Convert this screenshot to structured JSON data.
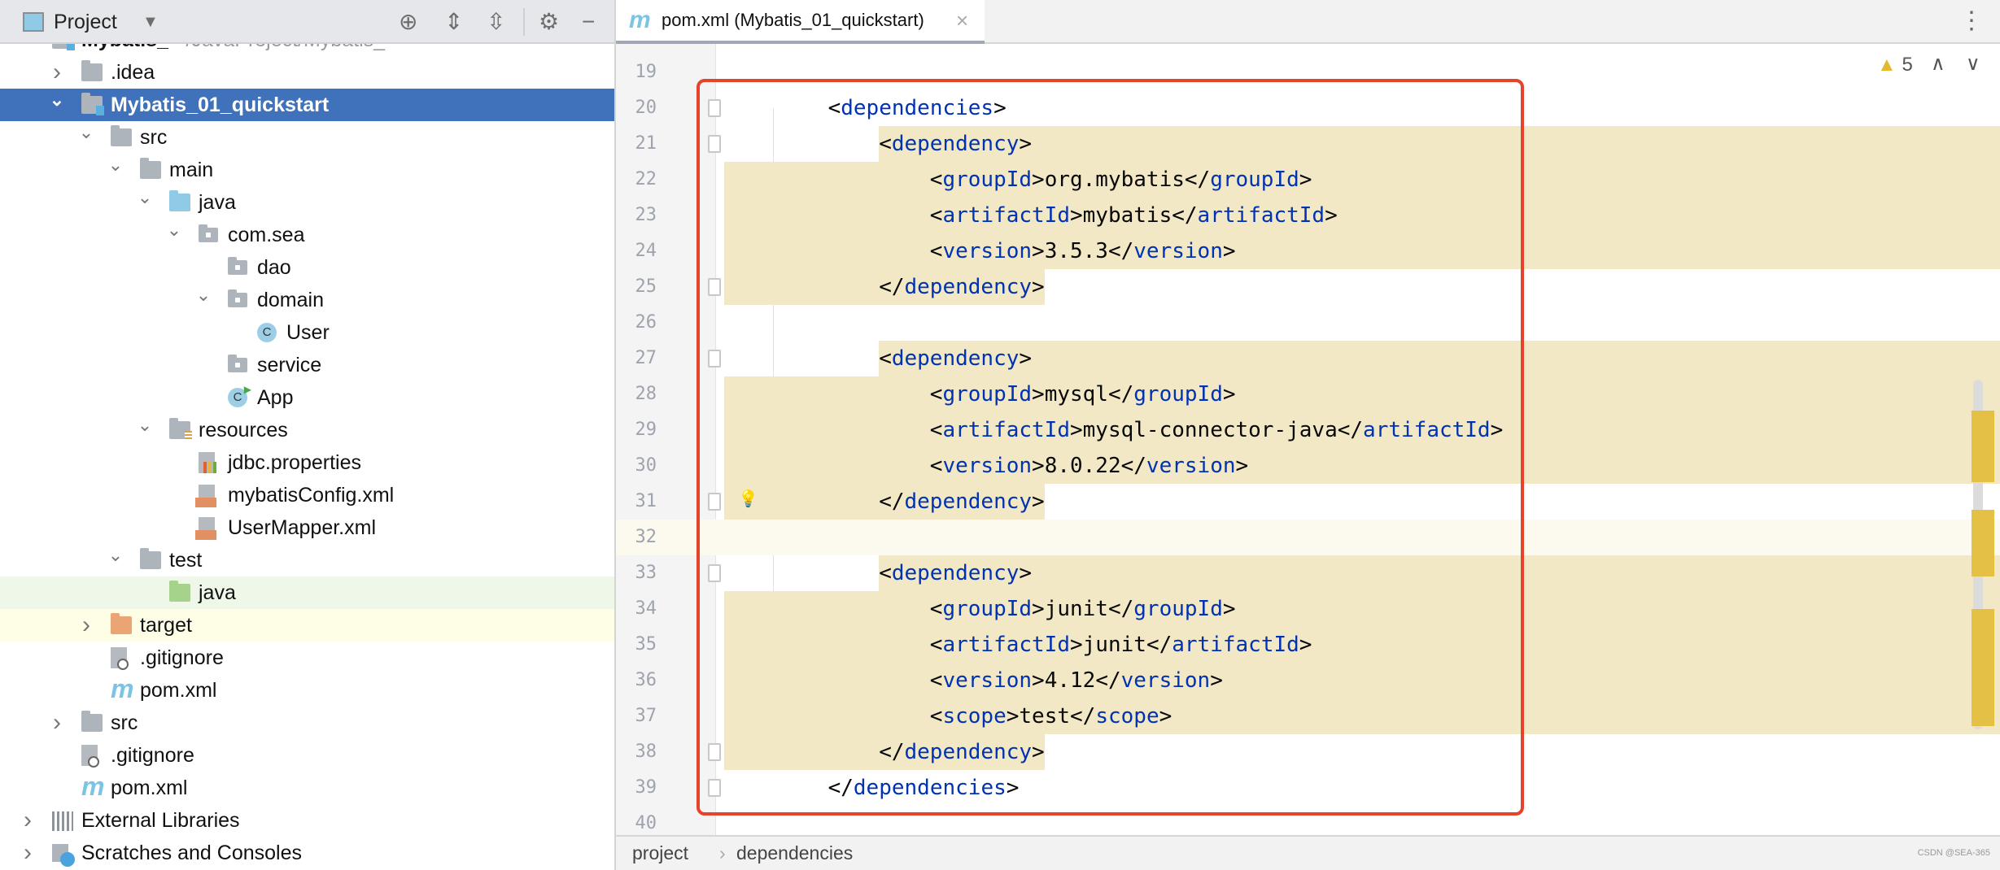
{
  "project_panel": {
    "title": "Project",
    "icons": [
      "locate-icon",
      "expand-all-icon",
      "collapse-all-icon",
      "gear-icon",
      "minimize-icon"
    ],
    "items": [
      {
        "label": "Mybatis_",
        "path": "~/JavaProject/Mybatis_",
        "level": -1,
        "arrow": "none",
        "icon": "module",
        "bold": true
      },
      {
        "label": ".idea",
        "level": 0,
        "arrow": "right",
        "icon": "folder"
      },
      {
        "label": "Mybatis_01_quickstart",
        "level": 0,
        "arrow": "down",
        "icon": "module",
        "state": "selected"
      },
      {
        "label": "src",
        "level": 1,
        "arrow": "down",
        "icon": "folder"
      },
      {
        "label": "main",
        "level": 2,
        "arrow": "down",
        "icon": "folder"
      },
      {
        "label": "java",
        "level": 3,
        "arrow": "down",
        "icon": "source-folder"
      },
      {
        "label": "com.sea",
        "level": 4,
        "arrow": "down",
        "icon": "package"
      },
      {
        "label": "dao",
        "level": 5,
        "arrow": "none",
        "icon": "package"
      },
      {
        "label": "domain",
        "level": 5,
        "arrow": "down",
        "icon": "package"
      },
      {
        "label": "User",
        "level": 6,
        "arrow": "none",
        "icon": "class"
      },
      {
        "label": "service",
        "level": 5,
        "arrow": "none",
        "icon": "package"
      },
      {
        "label": "App",
        "level": 5,
        "arrow": "none",
        "icon": "class-runnable"
      },
      {
        "label": "resources",
        "level": 3,
        "arrow": "down",
        "icon": "resources-folder"
      },
      {
        "label": "jdbc.properties",
        "level": 4,
        "arrow": "none",
        "icon": "properties-file"
      },
      {
        "label": "mybatisConfig.xml",
        "level": 4,
        "arrow": "none",
        "icon": "xml-file"
      },
      {
        "label": "UserMapper.xml",
        "level": 4,
        "arrow": "none",
        "icon": "xml-file"
      },
      {
        "label": "test",
        "level": 2,
        "arrow": "down",
        "icon": "folder"
      },
      {
        "label": "java",
        "level": 3,
        "arrow": "none",
        "icon": "test-folder",
        "state": "green"
      },
      {
        "label": "target",
        "level": 1,
        "arrow": "right",
        "icon": "excluded-folder",
        "state": "yellow"
      },
      {
        "label": ".gitignore",
        "level": 1,
        "arrow": "none",
        "icon": "ignore-file"
      },
      {
        "label": "pom.xml",
        "level": 1,
        "arrow": "none",
        "icon": "maven-file"
      },
      {
        "label": "src",
        "level": 0,
        "arrow": "right",
        "icon": "folder"
      },
      {
        "label": ".gitignore",
        "level": 0,
        "arrow": "none",
        "icon": "ignore-file"
      },
      {
        "label": "pom.xml",
        "level": 0,
        "arrow": "none",
        "icon": "maven-file"
      },
      {
        "label": "External Libraries",
        "level": -1,
        "arrow": "right",
        "icon": "libraries"
      },
      {
        "label": "Scratches and Consoles",
        "level": -1,
        "arrow": "right",
        "icon": "scratches"
      }
    ]
  },
  "editor": {
    "tab": {
      "label": "pom.xml (Mybatis_01_quickstart)",
      "icon": "maven-file-icon",
      "close": "×"
    },
    "more_icon": "⋮",
    "warnings": {
      "count": "5",
      "icon": "warning-icon"
    },
    "current_line": 32,
    "lines": [
      {
        "n": 19
      },
      {
        "n": 20,
        "indent": 1,
        "open": "dependencies",
        "fold": true
      },
      {
        "n": 21,
        "indent": 2,
        "open": "dependency",
        "fold": true,
        "hl": "from-tag"
      },
      {
        "n": 22,
        "indent": 3,
        "tag": "groupId",
        "value": "org.mybatis",
        "hl": "full"
      },
      {
        "n": 23,
        "indent": 3,
        "tag": "artifactId",
        "value": "mybatis",
        "hl": "full"
      },
      {
        "n": 24,
        "indent": 3,
        "tag": "version",
        "value": "3.5.3",
        "hl": "full"
      },
      {
        "n": 25,
        "indent": 2,
        "close": "dependency",
        "fold": true,
        "hl": "to-end"
      },
      {
        "n": 26
      },
      {
        "n": 27,
        "indent": 2,
        "open": "dependency",
        "fold": true,
        "hl": "from-tag"
      },
      {
        "n": 28,
        "indent": 3,
        "tag": "groupId",
        "value": "mysql",
        "hl": "full"
      },
      {
        "n": 29,
        "indent": 3,
        "tag": "artifactId",
        "value": "mysql-connector-java",
        "hl": "full"
      },
      {
        "n": 30,
        "indent": 3,
        "tag": "version",
        "value": "8.0.22",
        "hl": "full"
      },
      {
        "n": 31,
        "indent": 2,
        "close": "dependency",
        "fold": true,
        "hl": "to-end",
        "bulb": true
      },
      {
        "n": 32
      },
      {
        "n": 33,
        "indent": 2,
        "open": "dependency",
        "fold": true,
        "hl": "from-tag"
      },
      {
        "n": 34,
        "indent": 3,
        "tag": "groupId",
        "value": "junit",
        "hl": "full"
      },
      {
        "n": 35,
        "indent": 3,
        "tag": "artifactId",
        "value": "junit",
        "hl": "full"
      },
      {
        "n": 36,
        "indent": 3,
        "tag": "version",
        "value": "4.12",
        "hl": "full"
      },
      {
        "n": 37,
        "indent": 3,
        "tag": "scope",
        "value": "test",
        "hl": "full"
      },
      {
        "n": 38,
        "indent": 2,
        "close": "dependency",
        "fold": true,
        "hl": "to-end"
      },
      {
        "n": 39,
        "indent": 1,
        "close": "dependencies",
        "fold": true
      },
      {
        "n": 40
      }
    ]
  },
  "breadcrumb": {
    "items": [
      "project",
      "dependencies"
    ],
    "separator": "›"
  },
  "watermark": "CSDN @SEA-365",
  "colors": {
    "selection": "#3f72ba",
    "highlight": "#f2e8c5",
    "annotation_box": "#e6432c",
    "tag": "#0033b3"
  }
}
